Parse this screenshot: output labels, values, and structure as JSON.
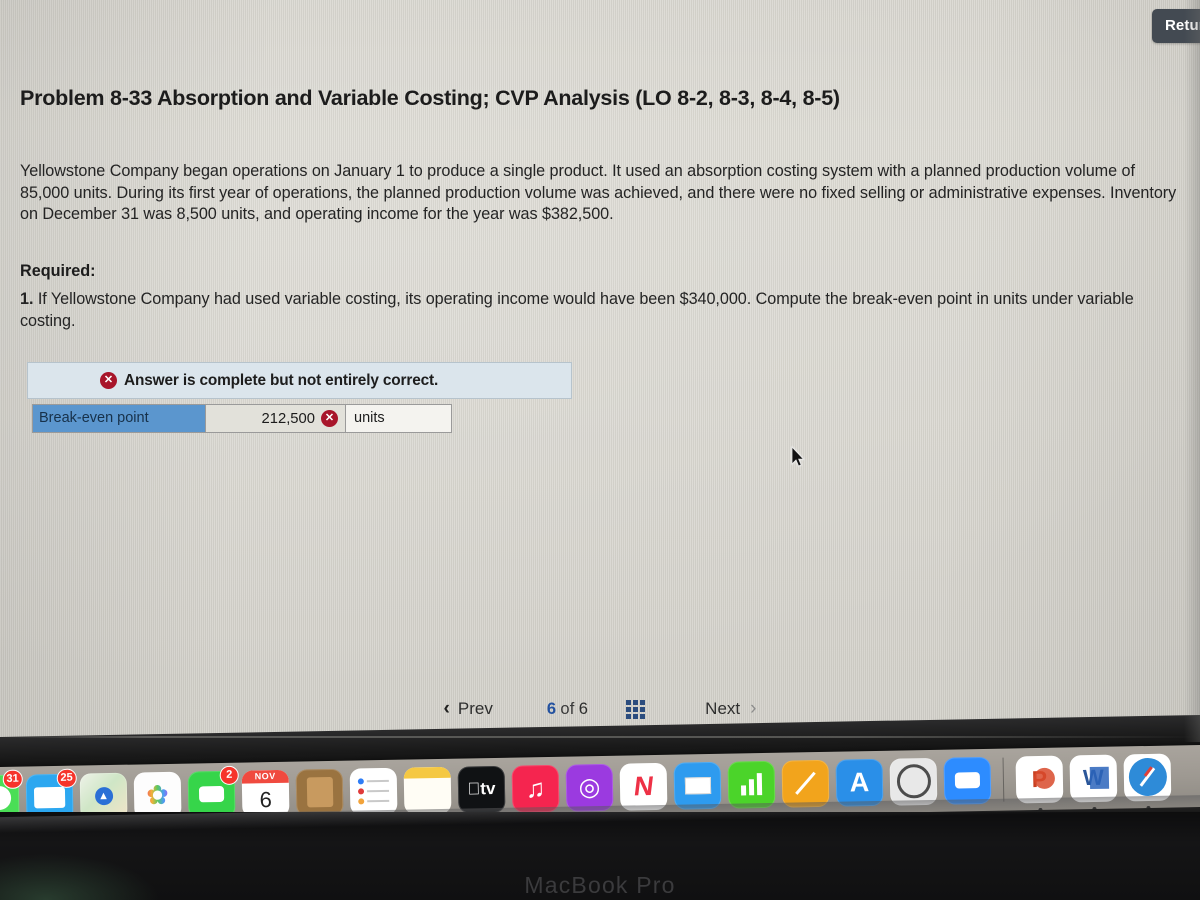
{
  "top_bar": {
    "return_button_label": "Return"
  },
  "problem": {
    "title": "Problem 8-33 Absorption and Variable Costing; CVP Analysis (LO 8-2, 8-3, 8-4, 8-5)",
    "body": "Yellowstone Company began operations on January 1 to produce a single product. It used an absorption costing system with a planned production volume of 85,000 units. During its first year of operations, the planned production volume was achieved, and there were no fixed selling or administrative expenses. Inventory on December 31 was 8,500 units, and operating income for the year was $382,500.",
    "required_label": "Required:",
    "required_number": "1.",
    "required_item": "If Yellowstone Company had used variable costing, its operating income would have been $340,000. Compute the break-even point in units under variable costing."
  },
  "answer": {
    "banner_text": "Answer is complete but not entirely correct.",
    "banner_icon": "x-circle-icon",
    "row": {
      "label": "Break-even point",
      "value": "212,500",
      "value_status_icon": "x-circle-icon",
      "units": "units"
    }
  },
  "pager": {
    "prev_label": "Prev",
    "prev_icon": "chevron-left-icon",
    "current_page": "6",
    "of_label": "of",
    "total_pages": "6",
    "grid_icon": "grid-3x3-icon",
    "next_label": "Next",
    "next_icon": "chevron-right-icon"
  },
  "cursor": {
    "icon": "mouse-pointer-icon"
  },
  "dock": {
    "items": [
      {
        "name": "messages",
        "glyph": "💬",
        "bg": "#4ade56",
        "badge": "31"
      },
      {
        "name": "mail",
        "glyph": "✉",
        "bg": "#2ca7f0",
        "badge": "25"
      },
      {
        "name": "maps",
        "glyph": "▲",
        "bg": "#e9f3e4",
        "badge": ""
      },
      {
        "name": "photos",
        "glyph": "✿",
        "bg": "#fdfdfd",
        "badge": ""
      },
      {
        "name": "facetime",
        "glyph": "▶",
        "bg": "#36d54a",
        "badge": "2"
      },
      {
        "name": "calendar",
        "glyph": "6",
        "bg": "#ffffff",
        "badge": ""
      },
      {
        "name": "contacts",
        "glyph": "☺",
        "bg": "#9a7340",
        "badge": ""
      },
      {
        "name": "reminders",
        "glyph": "☰",
        "bg": "#ffffff",
        "badge": ""
      },
      {
        "name": "notes",
        "glyph": "",
        "bg": "#fffdf4",
        "badge": ""
      },
      {
        "name": "apple-tv",
        "glyph": "tv",
        "bg": "#101214",
        "badge": ""
      },
      {
        "name": "music",
        "glyph": "♫",
        "bg": "#f5254f",
        "badge": ""
      },
      {
        "name": "podcasts",
        "glyph": "◉",
        "bg": "#9b3ae0",
        "badge": ""
      },
      {
        "name": "news",
        "glyph": "N",
        "bg": "#ffffff",
        "badge": ""
      },
      {
        "name": "keynote",
        "glyph": "▭",
        "bg": "#2e9bef",
        "badge": ""
      },
      {
        "name": "numbers",
        "glyph": "█",
        "bg": "#4bd42a",
        "badge": ""
      },
      {
        "name": "pages",
        "glyph": "✐",
        "bg": "#f2a41c",
        "badge": ""
      },
      {
        "name": "app-store",
        "glyph": "A",
        "bg": "#2a8fe8",
        "badge": ""
      },
      {
        "name": "system-settings",
        "glyph": "⚙",
        "bg": "#e8e8e8",
        "badge": ""
      },
      {
        "name": "zoom",
        "glyph": "▶",
        "bg": "#2d8cff",
        "badge": ""
      },
      {
        "name": "separator",
        "glyph": "",
        "bg": "",
        "badge": ""
      },
      {
        "name": "powerpoint",
        "glyph": "P",
        "bg": "#ffffff",
        "badge": ""
      },
      {
        "name": "word",
        "glyph": "W",
        "bg": "#ffffff",
        "badge": ""
      },
      {
        "name": "safari",
        "glyph": "✦",
        "bg": "#ffffff",
        "badge": ""
      }
    ],
    "calendar_month": "NOV",
    "calendar_day": "6"
  },
  "laptop": {
    "model_label": "MacBook Pro"
  }
}
